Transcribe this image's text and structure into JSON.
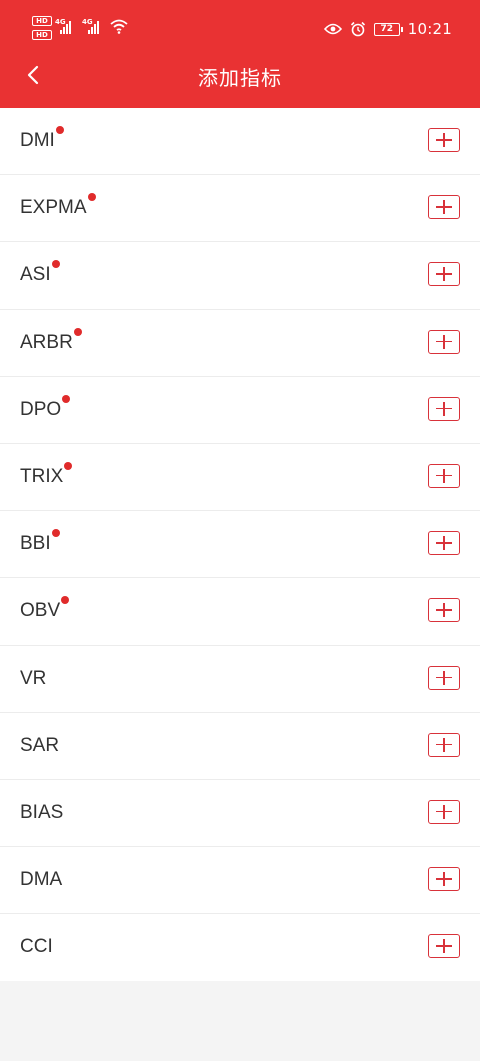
{
  "status_bar": {
    "network_a": "4G",
    "network_b": "4G",
    "battery": "72",
    "time": "10:21",
    "icons": [
      "hd-icon",
      "signal-icon",
      "wifi-icon",
      "eye-icon",
      "alarm-icon",
      "battery-icon"
    ]
  },
  "nav": {
    "title": "添加指标",
    "back_icon": "chevron-left-icon"
  },
  "indicators": [
    {
      "label": "DMI",
      "new": true
    },
    {
      "label": "EXPMA",
      "new": true
    },
    {
      "label": "ASI",
      "new": true
    },
    {
      "label": "ARBR",
      "new": true
    },
    {
      "label": "DPO",
      "new": true
    },
    {
      "label": "TRIX",
      "new": true
    },
    {
      "label": "BBI",
      "new": true
    },
    {
      "label": "OBV",
      "new": true
    },
    {
      "label": "VR",
      "new": false
    },
    {
      "label": "SAR",
      "new": false
    },
    {
      "label": "BIAS",
      "new": false
    },
    {
      "label": "DMA",
      "new": false
    },
    {
      "label": "CCI",
      "new": false
    }
  ],
  "colors": {
    "brand_red": "#e93233",
    "accent_red": "#d8323a",
    "dot_red": "#e02b2b"
  }
}
